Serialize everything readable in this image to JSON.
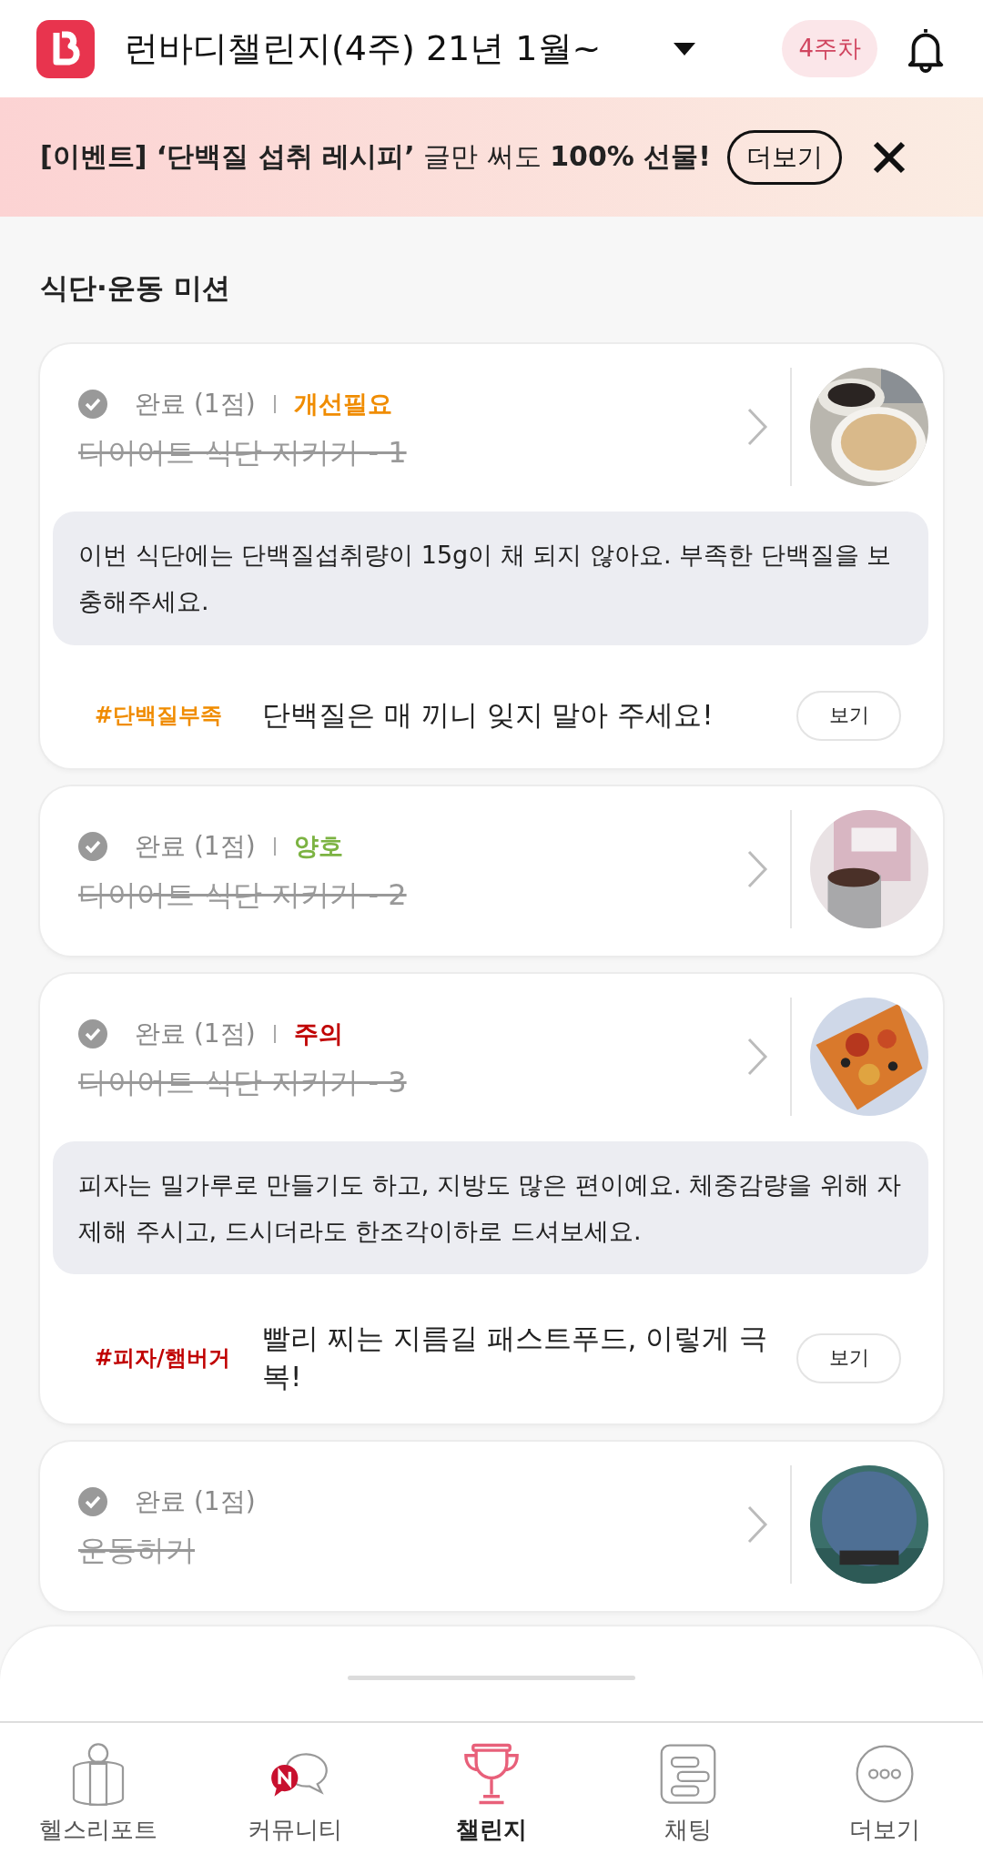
{
  "header": {
    "title": "런바디챌린지(4주) 21년 1월~",
    "week_badge": "4주차"
  },
  "banner": {
    "text": "**[이벤트] ‘단백질 섭취 레시피’** 글만 써도 **100% 선물!**",
    "button": "더보기"
  },
  "section_title": "식단·운동 미션",
  "missions": [
    {
      "completed": true,
      "status": "완료 (1점)",
      "grade": "개선필요",
      "color": "#f08c00",
      "title": "다이어트 식단 지키기 - 1",
      "comment": "이번 식단에는 단백질섭취량이 15g이 채 되지 않아요. 부족한 단백질을 보충해주세요.",
      "tag": "#단백질부족",
      "tip": "단백질은 매 끼니 잊지 말아 주세요!",
      "button": "보기"
    },
    {
      "completed": true,
      "status": "완료 (1점)",
      "grade": "양호",
      "color": "#7cb342",
      "title": "다이어트 식단 지키기 - 2"
    },
    {
      "completed": true,
      "status": "완료 (1점)",
      "grade": "주의",
      "color": "#c00000",
      "title": "다이어트 식단 지키기 - 3",
      "comment": "피자는 밀가루로 만들기도 하고, 지방도 많은 편이예요. 체중감량을 위해 자제해 주시고, 드시더라도 한조각이하로 드셔보세요.",
      "tag": "#피자/햄버거",
      "tip": "빨리 찌는 지름길 패스트푸드, 이렇게 극복!",
      "button": "보기"
    },
    {
      "completed": true,
      "status": "완료 (1점)",
      "title": "운동하기"
    }
  ],
  "nav": [
    {
      "label": "헬스리포트",
      "selected": false
    },
    {
      "label": "커뮤니티",
      "selected": false
    },
    {
      "label": "챌린지",
      "selected": true
    },
    {
      "label": "채팅",
      "selected": false
    },
    {
      "label": "더보기",
      "selected": false
    }
  ]
}
